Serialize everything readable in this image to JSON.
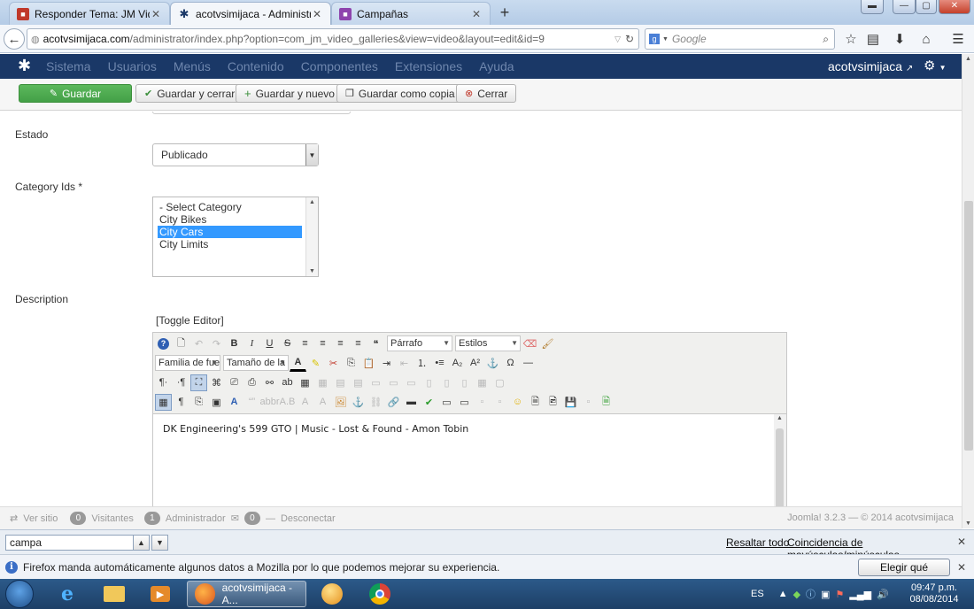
{
  "browser": {
    "tabs": [
      {
        "title": "Responder Tema: JM Video...",
        "active": false
      },
      {
        "title": "acotvsimijaca - Administra...",
        "active": true
      },
      {
        "title": "Campañas",
        "active": false
      }
    ],
    "url_host": "acotvsimijaca.com",
    "url_path": "/administrator/index.php?option=com_jm_video_galleries&view=video&layout=edit&id=9",
    "search_engine": "Google",
    "search_placeholder": "Google"
  },
  "joomla": {
    "menu": [
      "Sistema",
      "Usuarios",
      "Menús",
      "Contenido",
      "Componentes",
      "Extensiones",
      "Ayuda"
    ],
    "site_name": "acotvsimijaca",
    "toolbar": {
      "save": "Guardar",
      "save_close": "Guardar y cerrar",
      "save_new": "Guardar y nuevo",
      "save_copy": "Guardar como copia",
      "close": "Cerrar"
    }
  },
  "form": {
    "estado_label": "Estado",
    "estado_value": "Publicado",
    "category_label": "Category Ids *",
    "categories": [
      "- Select Category",
      "City Bikes",
      "City Cars",
      "City Limits"
    ],
    "selected_category": "City Cars",
    "description_label": "Description",
    "toggle_editor": "[Toggle Editor]",
    "editor": {
      "format_value": "Párrafo",
      "styles_value": "Estilos",
      "font_family_value": "Familia de fuer",
      "font_size_value": "Tamaño de la f",
      "content": "DK Engineering's 599 GTO | Music - Lost & Found - Amon Tobin"
    }
  },
  "status": {
    "view_site": "Ver sitio",
    "visitors_count": "0",
    "visitors_label": "Visitantes",
    "admin_count": "1",
    "admin_label": "Administrador",
    "messages_count": "0",
    "logout": "Desconectar",
    "copyright": "Joomla! 3.2.3 — © 2014 acotvsimijaca"
  },
  "findbar": {
    "query": "campa",
    "highlight_all": "Resaltar todo",
    "match_case": "Coincidencia de mayúsculas/minúsculas"
  },
  "notification": {
    "text": "Firefox manda automáticamente algunos datos a Mozilla por lo que podemos mejorar su experiencia.",
    "button": "Elegir qué comparto"
  },
  "taskbar": {
    "active_task": "acotvsimijaca - A...",
    "language": "ES",
    "time": "09:47 p.m.",
    "date": "08/08/2014"
  },
  "colors": {
    "joomla_header": "#1a3867",
    "save_green": "#5cb85c",
    "selection_blue": "#3399ff",
    "taskbar": "#2c5a8a"
  }
}
